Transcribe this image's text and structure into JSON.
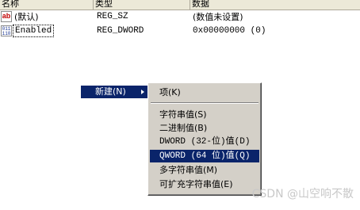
{
  "header": {
    "name": "名称",
    "type": "类型",
    "data": "数据"
  },
  "rows": [
    {
      "icon": "string-value-icon",
      "name": "(默认)",
      "type": "REG_SZ",
      "data": "(数值未设置)"
    },
    {
      "icon": "dword-value-icon",
      "name": "Enabled",
      "type": "REG_DWORD",
      "data": "0x00000000 (0)"
    }
  ],
  "context_menu": {
    "new_label": "新建(N)"
  },
  "submenu": {
    "items": [
      "项(K)",
      "字符串值(S)",
      "二进制值(B)",
      "DWORD (32-位)值(D)",
      "QWORD (64 位)值(Q)",
      "多字符串值(M)",
      "可扩充字符串值(E)"
    ],
    "selected_index": 4
  },
  "watermark": "CSDN @山空响不散",
  "colors": {
    "highlight": "#0a246a",
    "menu_bg": "#d4d0c8",
    "header_bg": "#ece9d8"
  }
}
